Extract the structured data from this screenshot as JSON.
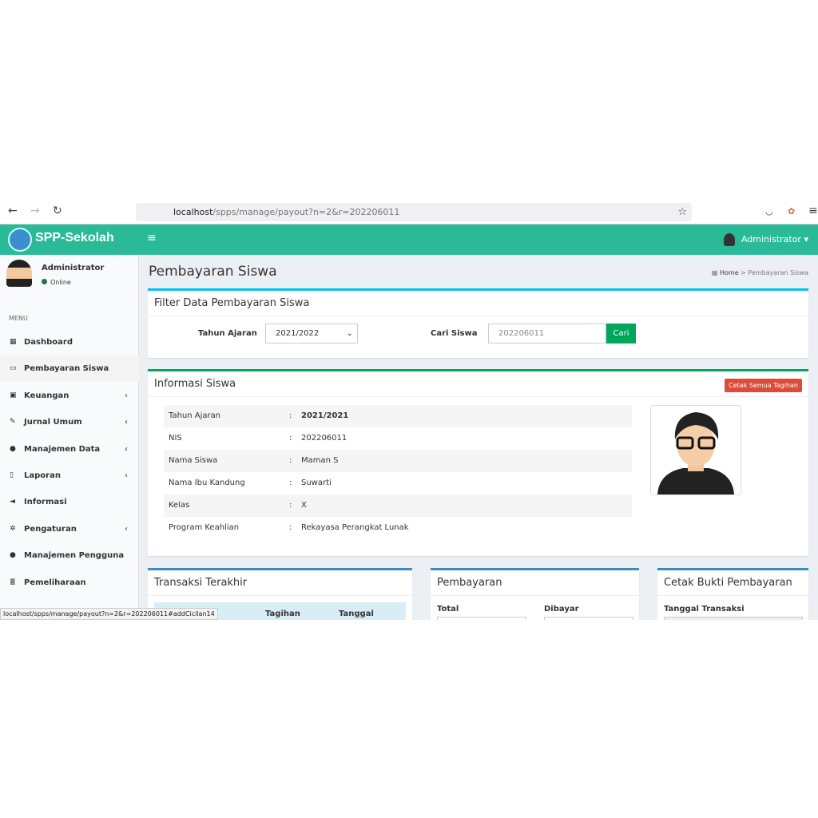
{
  "browser": {
    "url_host": "localhost",
    "url_path": "/spps/manage/payout?n=2&r=202206011",
    "status_url": "localhost/spps/manage/payout?n=2&r=202206011#addCicilan14"
  },
  "header": {
    "brand": "SPP-Sekolah",
    "user": "Administrator"
  },
  "sidebar": {
    "user": "Administrator",
    "status": "Online",
    "menu_header": "MENU",
    "items": [
      {
        "label": "Dashboard",
        "icon": "th-icon"
      },
      {
        "label": "Pembayaran Siswa",
        "icon": "credit-card-icon"
      },
      {
        "label": "Keuangan",
        "icon": "money-icon"
      },
      {
        "label": "Jurnal Umum",
        "icon": "edit-icon"
      },
      {
        "label": "Manajemen Data",
        "icon": "users-icon"
      },
      {
        "label": "Laporan",
        "icon": "file-icon"
      },
      {
        "label": "Informasi",
        "icon": "bullhorn-icon"
      },
      {
        "label": "Pengaturan",
        "icon": "cog-icon"
      },
      {
        "label": "Manajemen Pengguna",
        "icon": "user-icon"
      },
      {
        "label": "Pemeliharaan",
        "icon": "database-icon"
      }
    ]
  },
  "page": {
    "title": "Pembayaran Siswa",
    "breadcrumb_home": "Home",
    "breadcrumb_current": "Pembayaran Siswa"
  },
  "filter": {
    "title": "Filter Data Pembayaran Siswa",
    "year_label": "Tahun Ajaran",
    "year_value": "2021/2022",
    "search_label": "Cari Siswa",
    "search_value": "202206011",
    "search_button": "Cari"
  },
  "info": {
    "title": "Informasi Siswa",
    "print_all": "Cetak Semua Tagihan",
    "rows": [
      {
        "k": "Tahun Ajaran",
        "v": "2021/2021"
      },
      {
        "k": "NIS",
        "v": "202206011"
      },
      {
        "k": "Nama Siswa",
        "v": "Maman S"
      },
      {
        "k": "Nama Ibu Kandung",
        "v": "Suwarti"
      },
      {
        "k": "Kelas",
        "v": "X"
      },
      {
        "k": "Program Keahlian",
        "v": "Rekayasa Perangkat Lunak"
      }
    ]
  },
  "transaksi": {
    "title": "Transaksi Terakhir",
    "col_tagihan": "Tagihan",
    "col_tanggal": "Tanggal"
  },
  "pembayaran": {
    "title": "Pembayaran",
    "total": "Total",
    "dibayar": "Dibayar"
  },
  "cetak": {
    "title": "Cetak Bukti Pembayaran",
    "tanggal": "Tanggal Transaksi"
  }
}
